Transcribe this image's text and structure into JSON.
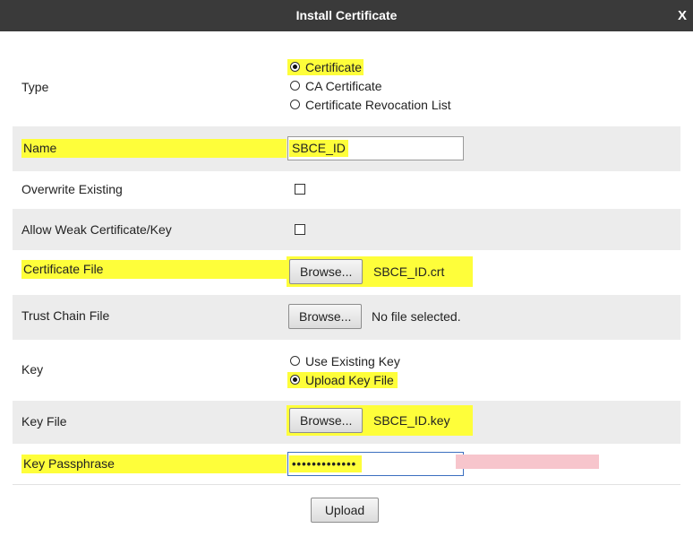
{
  "dialog": {
    "title": "Install Certificate",
    "close_label": "X"
  },
  "type": {
    "label": "Type",
    "options": [
      "Certificate",
      "CA Certificate",
      "Certificate Revocation List"
    ],
    "selected": "Certificate"
  },
  "name": {
    "label": "Name",
    "value": "SBCE_ID"
  },
  "overwrite": {
    "label": "Overwrite Existing",
    "checked": false
  },
  "weak": {
    "label": "Allow Weak Certificate/Key",
    "checked": false
  },
  "cert_file": {
    "label": "Certificate File",
    "button": "Browse...",
    "file": "SBCE_ID.crt"
  },
  "trust_chain": {
    "label": "Trust Chain File",
    "button": "Browse...",
    "file": "No file selected."
  },
  "key": {
    "label": "Key",
    "options": [
      "Use Existing Key",
      "Upload Key File"
    ],
    "selected": "Upload Key File"
  },
  "key_file": {
    "label": "Key File",
    "button": "Browse...",
    "file": "SBCE_ID.key"
  },
  "passphrase": {
    "label": "Key Passphrase",
    "value": "•••••••••••••"
  },
  "upload_label": "Upload",
  "colors": {
    "highlight": "#fefe3a",
    "titlebar": "#3a3a3a",
    "shade": "#ececec"
  }
}
